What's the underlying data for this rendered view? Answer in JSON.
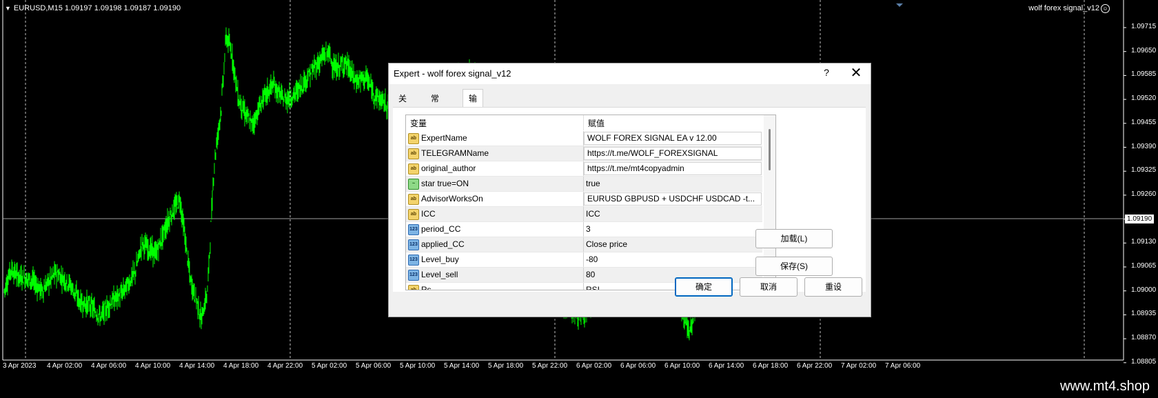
{
  "chart": {
    "symbol_info": "EURUSD,M15  1.09197 1.09198 1.09187 1.09190",
    "ea_name": "wolf forex signal_v12",
    "price_scale": [
      "1.09715",
      "1.09650",
      "1.09585",
      "1.09520",
      "1.09455",
      "1.09390",
      "1.09325",
      "1.09260",
      "1.09190",
      "1.09130",
      "1.09065",
      "1.09000",
      "1.08935",
      "1.08870",
      "1.08805"
    ],
    "current_price": "1.09190",
    "time_scale": [
      "3 Apr 2023",
      "4 Apr 02:00",
      "4 Apr 06:00",
      "4 Apr 10:00",
      "4 Apr 14:00",
      "4 Apr 18:00",
      "4 Apr 22:00",
      "5 Apr 02:00",
      "5 Apr 06:00",
      "5 Apr 10:00",
      "5 Apr 14:00",
      "5 Apr 18:00",
      "5 Apr 22:00",
      "6 Apr 02:00",
      "6 Apr 06:00",
      "6 Apr 10:00",
      "6 Apr 14:00",
      "6 Apr 18:00",
      "6 Apr 22:00",
      "7 Apr 02:00",
      "7 Apr 06:00"
    ],
    "candle_color": "#00ff00",
    "grid_color": "#c0c0c0"
  },
  "watermark": "www.mt4.shop",
  "dialog": {
    "title": "Expert - wolf forex signal_v12",
    "help_label": "?",
    "close_label": "✕",
    "tabs": [
      {
        "label": "关于"
      },
      {
        "label": "常用"
      },
      {
        "label": "输入参数"
      }
    ],
    "table": {
      "col_variable": "变量",
      "col_value": "赋值",
      "rows": [
        {
          "icon": "ab",
          "name": "ExpertName",
          "value": "WOLF FOREX SIGNAL EA v 12.00"
        },
        {
          "icon": "ab",
          "name": "TELEGRAMName",
          "value": "https://t.me/WOLF_FOREXSIGNAL"
        },
        {
          "icon": "ab",
          "name": "original_author",
          "value": "https://t.me/mt4copyadmin"
        },
        {
          "icon": "bool",
          "name": "star true=ON",
          "value": "true"
        },
        {
          "icon": "ab",
          "name": "AdvisorWorksOn",
          "value": "EURUSD GBPUSD + USDCHF USDCAD  -t..."
        },
        {
          "icon": "ab",
          "name": "ICC",
          "value": "ICC"
        },
        {
          "icon": "num",
          "name": "period_CC",
          "value": "3"
        },
        {
          "icon": "num",
          "name": "applied_CC",
          "value": "Close price"
        },
        {
          "icon": "num",
          "name": "Level_buy",
          "value": "-80"
        },
        {
          "icon": "num",
          "name": "Level_sell",
          "value": "80"
        },
        {
          "icon": "ab",
          "name": "Rs",
          "value": "RSI"
        }
      ]
    },
    "buttons": {
      "load": "加载(L)",
      "save": "保存(S)",
      "ok": "确定",
      "cancel": "取消",
      "reset": "重设"
    }
  }
}
